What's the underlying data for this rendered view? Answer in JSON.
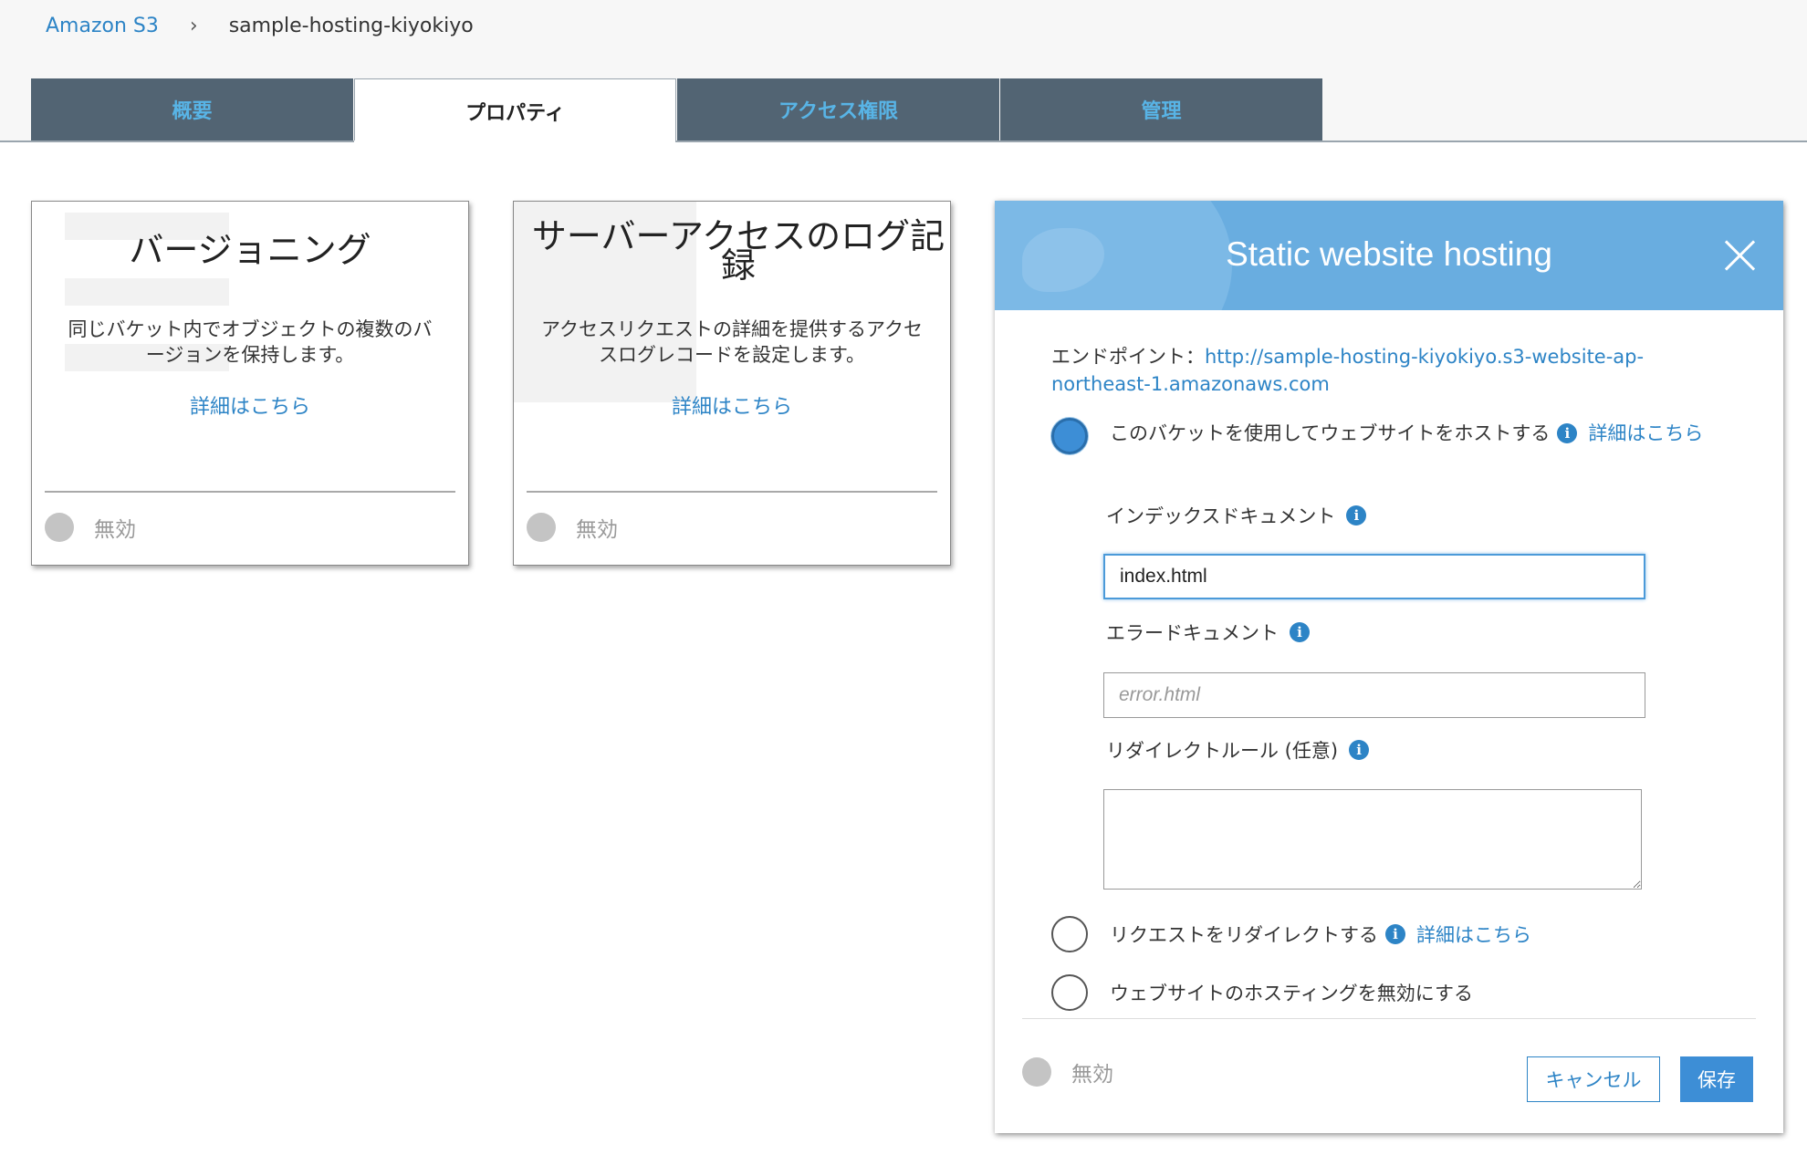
{
  "breadcrumb": {
    "root": "Amazon S3",
    "separator": "›",
    "current": "sample-hosting-kiyokiyo"
  },
  "tabs": [
    {
      "label": "概要"
    },
    {
      "label": "プロパティ"
    },
    {
      "label": "アクセス権限"
    },
    {
      "label": "管理"
    }
  ],
  "cards": [
    {
      "title": "バージョニング",
      "description": "同じバケット内でオブジェクトの複数のバージョンを保持します。",
      "link": "詳細はこちら",
      "status": "無効"
    },
    {
      "title": "サーバーアクセスのログ記録",
      "description": "アクセスリクエストの詳細を提供するアクセスログレコードを設定します。",
      "link": "詳細はこちら",
      "status": "無効"
    }
  ],
  "hosting": {
    "title": "Static website hosting",
    "endpoint_label": "エンドポイント：",
    "endpoint_url": "http://sample-hosting-kiyokiyo.s3-website-ap-northeast-1.amazonaws.com",
    "option_host": {
      "label": "このバケットを使用してウェブサイトをホストする",
      "link": "詳細はこちら"
    },
    "index_label": "インデックスドキュメント",
    "index_value": "index.html",
    "error_label": "エラードキュメント",
    "error_placeholder": "error.html",
    "redirect_rules_label": "リダイレクトルール (任意)",
    "option_redirect": {
      "label": "リクエストをリダイレクトする",
      "link": "詳細はこちら"
    },
    "option_disable": {
      "label": "ウェブサイトのホスティングを無効にする"
    },
    "status": "無効",
    "cancel_label": "キャンセル",
    "save_label": "保存",
    "info_glyph": "i"
  },
  "colors": {
    "accent": "#2d84c6",
    "tab_bg": "#526473",
    "header_bg": "#69ade0"
  }
}
